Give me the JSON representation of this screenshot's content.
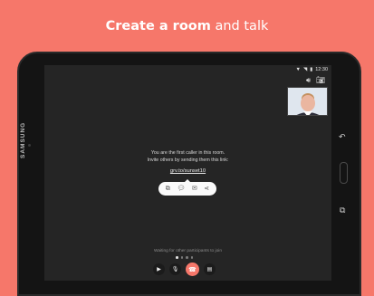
{
  "headline": {
    "bold": "Create a room",
    "rest": "and talk"
  },
  "device": {
    "brand": "SAMSUNG"
  },
  "status_bar": {
    "time": "12:30"
  },
  "call": {
    "message_line1": "You are the first caller in this room.",
    "message_line2": "Invite others by sending them this link:",
    "room_link": "grv.to/sunset10",
    "waiting_text": "Waiting for other participants to join",
    "carousel_active_index": 0,
    "carousel_total": 4
  },
  "share_actions": [
    "copy-icon",
    "chat-icon",
    "sms-icon",
    "share-icon"
  ],
  "call_controls": [
    "video-off-icon",
    "mic-off-icon",
    "hang-up-icon",
    "chat-icon"
  ],
  "colors": {
    "background": "#f6776a",
    "hangup": "#f6776a",
    "screen": "#252525"
  }
}
